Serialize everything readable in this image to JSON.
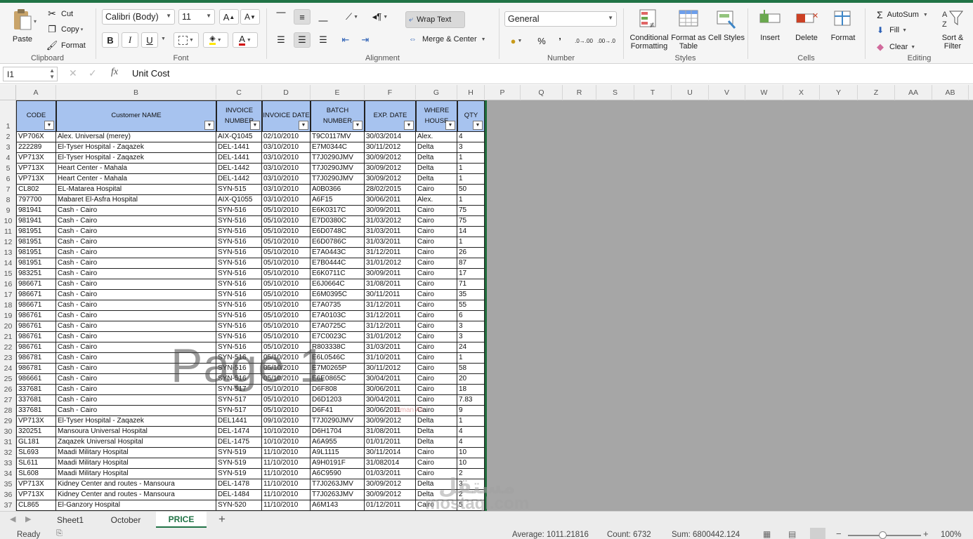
{
  "ribbon": {
    "clipboard": {
      "paste": "Paste",
      "cut": "Cut",
      "copy": "Copy",
      "format": "Format",
      "label": "Clipboard"
    },
    "font": {
      "name": "Calibri (Body)",
      "size": "11",
      "label": "Font",
      "bold": "B",
      "italic": "I",
      "underline": "U",
      "font_color": "#d00000",
      "highlight_color": "#ffe600"
    },
    "alignment": {
      "wrap": "Wrap Text",
      "merge": "Merge & Center",
      "label": "Alignment"
    },
    "number": {
      "format": "General",
      "percent": "%",
      "comma": "’",
      "inc": ".0→.00",
      "dec": ".00→.0",
      "label": "Number"
    },
    "styles": {
      "cond": "Conditional Formatting",
      "fmt_table": "Format as Table",
      "cell_styles": "Cell Styles",
      "label": "Styles"
    },
    "cells": {
      "insert": "Insert",
      "delete": "Delete",
      "format": "Format",
      "label": "Cells"
    },
    "editing": {
      "autosum": "AutoSum",
      "fill": "Fill",
      "clear": "Clear",
      "sort": "Sort & Filter",
      "label": "Editing"
    }
  },
  "formula_bar": {
    "name_box": "I1",
    "fx": "fx",
    "formula": "Unit Cost"
  },
  "column_letters": [
    "A",
    "B",
    "C",
    "D",
    "E",
    "F",
    "G",
    "H",
    "P",
    "Q",
    "R",
    "S",
    "T",
    "U",
    "V",
    "W",
    "X",
    "Y",
    "Z",
    "AA",
    "AB"
  ],
  "header_row": {
    "number": "1",
    "cells": [
      "CODE",
      "Customer  NAME",
      "INVOICE NUMBER",
      "INVOICE DATE",
      "BATCH NUMBER",
      "EXP. DATE",
      "WHERE HOUSE",
      "QTY"
    ]
  },
  "rows": [
    {
      "n": "2",
      "c": [
        "VP706X",
        "Alex. Universal  (merey)",
        "AIX-Q1045",
        "02/10/2010",
        "T9C0117MV",
        "30/03/2014",
        "Alex.",
        "4"
      ]
    },
    {
      "n": "3",
      "c": [
        "222289",
        "El-Tyser Hospital - Zaqazek",
        "DEL-1441",
        "03/10/2010",
        "E7M0344C",
        "30/11/2012",
        "Delta",
        "3"
      ]
    },
    {
      "n": "4",
      "c": [
        "VP713X",
        "El-Tyser Hospital - Zaqazek",
        "DEL-1441",
        "03/10/2010",
        "T7J0290JMV",
        "30/09/2012",
        "Delta",
        "1"
      ]
    },
    {
      "n": "5",
      "c": [
        "VP713X",
        "Heart Center - Mahala",
        "DEL-1442",
        "03/10/2010",
        "T7J0290JMV",
        "30/09/2012",
        "Delta",
        "1"
      ]
    },
    {
      "n": "6",
      "c": [
        "VP713X",
        "Heart Center - Mahala",
        "DEL-1442",
        "03/10/2010",
        "T7J0290JMV",
        "30/09/2012",
        "Delta",
        "1"
      ]
    },
    {
      "n": "7",
      "c": [
        "CL802",
        "EL-Matarea Hospital",
        "SYN-515",
        "03/10/2010",
        "A0B0366",
        "28/02/2015",
        "Cairo",
        "50"
      ]
    },
    {
      "n": "8",
      "c": [
        "797700",
        "Mabaret El-Asfra Hospital",
        "AIX-Q1055",
        "03/10/2010",
        "A6F15",
        "30/06/2011",
        "Alex.",
        "1"
      ]
    },
    {
      "n": "9",
      "c": [
        "981941",
        "Cash - Cairo",
        "SYN-516",
        "05/10/2010",
        "E6K0317C",
        "30/09/2011",
        "Cairo",
        "75"
      ]
    },
    {
      "n": "10",
      "c": [
        "981941",
        "Cash - Cairo",
        "SYN-516",
        "05/10/2010",
        "E7D0380C",
        "31/03/2012",
        "Cairo",
        "75"
      ]
    },
    {
      "n": "11",
      "c": [
        "981951",
        "Cash - Cairo",
        "SYN-516",
        "05/10/2010",
        "E6D0748C",
        "31/03/2011",
        "Cairo",
        "14"
      ]
    },
    {
      "n": "12",
      "c": [
        "981951",
        "Cash - Cairo",
        "SYN-516",
        "05/10/2010",
        "E6D0786C",
        "31/03/2011",
        "Cairo",
        "1"
      ]
    },
    {
      "n": "13",
      "c": [
        "981951",
        "Cash - Cairo",
        "SYN-516",
        "05/10/2010",
        "E7A0443C",
        "31/12/2011",
        "Cairo",
        "26"
      ]
    },
    {
      "n": "14",
      "c": [
        "981951",
        "Cash - Cairo",
        "SYN-516",
        "05/10/2010",
        "E7B0444C",
        "31/01/2012",
        "Cairo",
        "87"
      ]
    },
    {
      "n": "15",
      "c": [
        "983251",
        "Cash - Cairo",
        "SYN-516",
        "05/10/2010",
        "E6K0711C",
        "30/09/2011",
        "Cairo",
        "17"
      ]
    },
    {
      "n": "16",
      "c": [
        "986671",
        "Cash - Cairo",
        "SYN-516",
        "05/10/2010",
        "E6J0664C",
        "31/08/2011",
        "Cairo",
        "71"
      ]
    },
    {
      "n": "17",
      "c": [
        "986671",
        "Cash - Cairo",
        "SYN-516",
        "05/10/2010",
        "E6M0395C",
        "30/11/2011",
        "Cairo",
        "35"
      ]
    },
    {
      "n": "18",
      "c": [
        "986671",
        "Cash - Cairo",
        "SYN-516",
        "05/10/2010",
        "E7A0735",
        "31/12/2011",
        "Cairo",
        "55"
      ]
    },
    {
      "n": "19",
      "c": [
        "986761",
        "Cash - Cairo",
        "SYN-516",
        "05/10/2010",
        "E7A0103C",
        "31/12/2011",
        "Cairo",
        "6"
      ]
    },
    {
      "n": "20",
      "c": [
        "986761",
        "Cash - Cairo",
        "SYN-516",
        "05/10/2010",
        "E7A0725C",
        "31/12/2011",
        "Cairo",
        "3"
      ]
    },
    {
      "n": "21",
      "c": [
        "986761",
        "Cash - Cairo",
        "SYN-516",
        "05/10/2010",
        "E7C0023C",
        "31/01/2012",
        "Cairo",
        "3"
      ]
    },
    {
      "n": "22",
      "c": [
        "986761",
        "Cash - Cairo",
        "SYN-516",
        "05/10/2010",
        "R803338C",
        "31/03/2011",
        "Cairo",
        "24"
      ]
    },
    {
      "n": "23",
      "c": [
        "986781",
        "Cash - Cairo",
        "SYN-516",
        "05/10/2010",
        "E6L0546C",
        "31/10/2011",
        "Cairo",
        "1"
      ]
    },
    {
      "n": "24",
      "c": [
        "986781",
        "Cash - Cairo",
        "SYN-516",
        "05/10/2010",
        "E7M0265P",
        "30/11/2012",
        "Cairo",
        "58"
      ]
    },
    {
      "n": "25",
      "c": [
        "986661",
        "Cash - Cairo",
        "SYN-516",
        "05/10/2010",
        "E6E0865C",
        "30/04/2011",
        "Cairo",
        "20"
      ]
    },
    {
      "n": "26",
      "c": [
        "337681",
        "Cash - Cairo",
        "SYN-517",
        "05/10/2010",
        "D6F808",
        "30/06/2011",
        "Cairo",
        "18"
      ]
    },
    {
      "n": "27",
      "c": [
        "337681",
        "Cash - Cairo",
        "SYN-517",
        "05/10/2010",
        "D6D1203",
        "30/04/2011",
        "Cairo",
        "7.83"
      ]
    },
    {
      "n": "28",
      "c": [
        "337681",
        "Cash - Cairo",
        "SYN-517",
        "05/10/2010",
        "D6F41",
        "30/06/2011",
        "Cairo",
        "9"
      ]
    },
    {
      "n": "29",
      "c": [
        "VP713X",
        "El-Tyser Hospital - Zaqazek",
        "DEL1441",
        "09/10/2010",
        "T7J0290JMV",
        "30/09/2012",
        "Delta",
        "1"
      ]
    },
    {
      "n": "30",
      "c": [
        "320251",
        "Mansoura Universal Hospital",
        "DEL-1474",
        "10/10/2010",
        "D6H1704",
        "31/08/2011",
        "Delta",
        "4"
      ]
    },
    {
      "n": "31",
      "c": [
        "GL181",
        "Zaqazek Universal Hospital",
        "DEL-1475",
        "10/10/2010",
        "A6A955",
        "01/01/2011",
        "Delta",
        "4"
      ]
    },
    {
      "n": "32",
      "c": [
        "SL693",
        "Maadi Military Hospital",
        "SYN-519",
        "11/10/2010",
        "A9L1115",
        "30/11/2014",
        "Cairo",
        "10"
      ]
    },
    {
      "n": "33",
      "c": [
        "SL611",
        "Maadi Military Hospital",
        "SYN-519",
        "11/10/2010",
        "A9H0191F",
        "31/082014",
        "Cairo",
        "10"
      ]
    },
    {
      "n": "34",
      "c": [
        "SL608",
        "Maadi Military Hospital",
        "SYN-519",
        "11/10/2010",
        "A6C9590",
        "01/03/2011",
        "Cairo",
        "2"
      ]
    },
    {
      "n": "35",
      "c": [
        "VP713X",
        "Kidney Center and routes - Mansoura",
        "DEL-1478",
        "11/10/2010",
        "T7J0263JMV",
        "30/09/2012",
        "Delta",
        "3"
      ]
    },
    {
      "n": "36",
      "c": [
        "VP713X",
        "Kidney Center and routes - Mansoura",
        "DEL-1484",
        "11/10/2010",
        "T7J0263JMV",
        "30/09/2012",
        "Delta",
        "2"
      ]
    },
    {
      "n": "37",
      "c": [
        "CL865",
        "El-Ganzory  Hospital",
        "SYN-520",
        "11/10/2010",
        "A6M143",
        "01/12/2011",
        "Cairo",
        "5"
      ]
    }
  ],
  "watermarks": {
    "page": "Page 1",
    "mostaql_ar": "مستقل",
    "mostaql": "mostaql.com",
    "small": "Eman Ali"
  },
  "tabs": [
    "Sheet1",
    "October",
    "PRICE"
  ],
  "active_tab": "PRICE",
  "status": {
    "ready": "Ready",
    "average": "Average: 1011.21816",
    "count": "Count: 6732",
    "sum": "Sum: 6800442.124",
    "zoom": "100%"
  },
  "colors": {
    "accent": "#217346",
    "header_fill": "#a7c3ef",
    "grey_area": "#a6a6a6"
  }
}
